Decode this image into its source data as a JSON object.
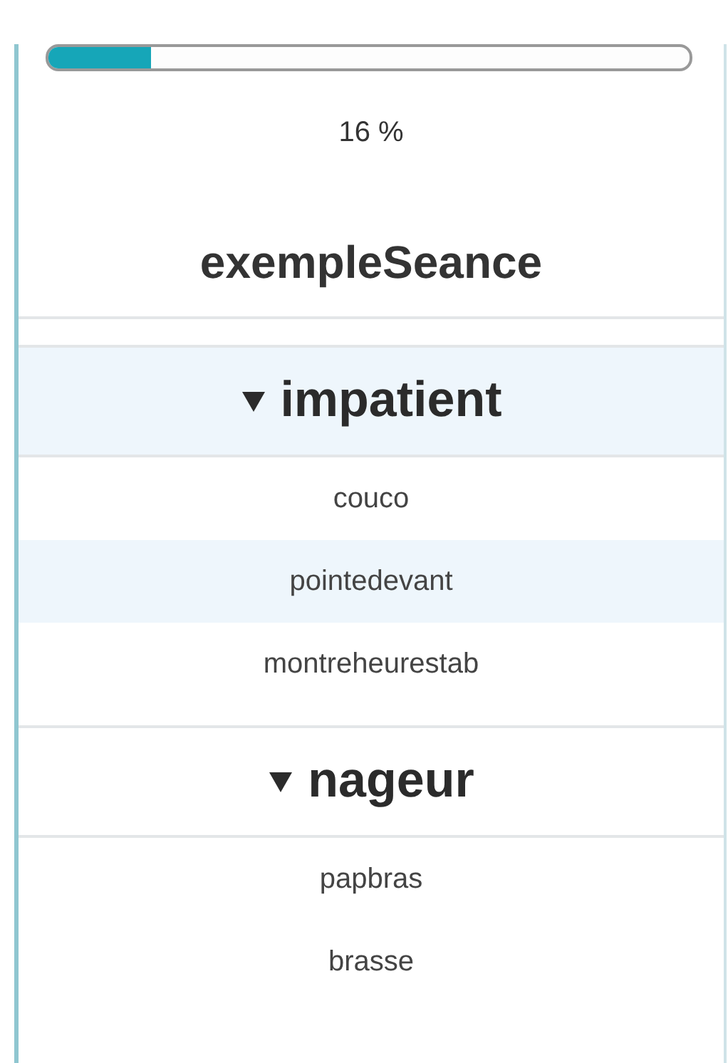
{
  "progress": {
    "level": 0.16,
    "reading": "16 %"
  },
  "session": {
    "title": "exempleSeance"
  },
  "groups": [
    {
      "name": "impatient",
      "expanded": true,
      "selected": true,
      "items": [
        {
          "label": "couco",
          "selected": false
        },
        {
          "label": "pointedevant",
          "selected": true
        },
        {
          "label": "montreheurestab",
          "selected": false
        }
      ]
    },
    {
      "name": "nageur",
      "expanded": true,
      "selected": false,
      "items": [
        {
          "label": "papbras",
          "selected": false
        },
        {
          "label": "brasse",
          "selected": false
        }
      ]
    }
  ]
}
